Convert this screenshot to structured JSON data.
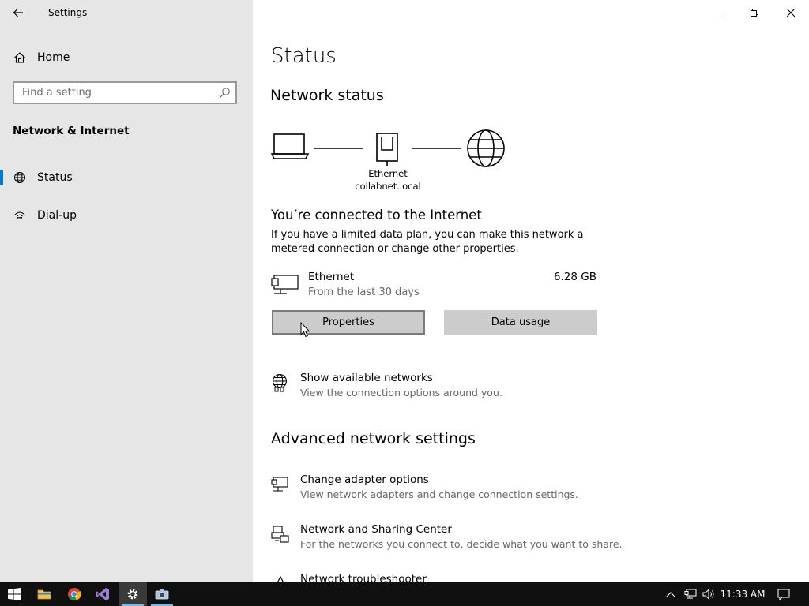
{
  "window": {
    "title": "Settings",
    "controls": [
      "minimize",
      "restore",
      "close"
    ]
  },
  "sidebar": {
    "home_label": "Home",
    "search_placeholder": "Find a setting",
    "section_title": "Network & Internet",
    "items": [
      {
        "label": "Status",
        "icon": "globe-icon",
        "active": true
      },
      {
        "label": "Dial-up",
        "icon": "dialup-icon",
        "active": false
      }
    ]
  },
  "main": {
    "page_title": "Status",
    "network_status_heading": "Network status",
    "diagram": {
      "adapter_name": "Ethernet",
      "network_name": "collabnet.local"
    },
    "connected_heading": "You’re connected to the Internet",
    "connected_desc_line1": "If you have a limited data plan, you can make this network a",
    "connected_desc_line2": "metered connection or change other properties.",
    "connection": {
      "name": "Ethernet",
      "subtitle": "From the last 30 days",
      "usage": "6.28 GB"
    },
    "buttons": {
      "properties": "Properties",
      "data_usage": "Data usage"
    },
    "show_networks": {
      "title": "Show available networks",
      "desc": "View the connection options around you."
    },
    "advanced_heading": "Advanced network settings",
    "advanced_items": [
      {
        "title": "Change adapter options",
        "desc": "View network adapters and change connection settings.",
        "icon": "adapter-icon"
      },
      {
        "title": "Network and Sharing Center",
        "desc": "For the networks you connect to, decide what you want to share.",
        "icon": "sharing-center-icon"
      },
      {
        "title": "Network troubleshooter",
        "desc": "",
        "icon": "troubleshooter-icon"
      }
    ]
  },
  "taskbar": {
    "apps": [
      "windows-start",
      "file-explorer",
      "chrome",
      "visual-studio",
      "settings",
      "camera"
    ],
    "time": "11:33 AM"
  },
  "colors": {
    "accent": "#0078d7",
    "sidebar_bg": "#e6e6e6",
    "taskbar_bg": "#101010"
  }
}
